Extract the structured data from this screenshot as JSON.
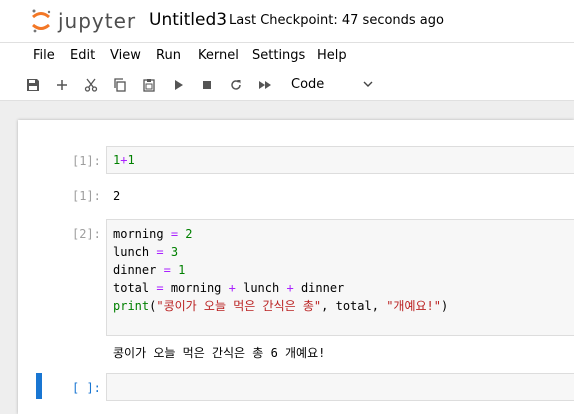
{
  "header": {
    "logo_text": "jupyter",
    "notebook_title": "Untitled3",
    "checkpoint": "Last Checkpoint: 47 seconds ago"
  },
  "menu": [
    "File",
    "Edit",
    "View",
    "Run",
    "Kernel",
    "Settings",
    "Help"
  ],
  "toolbar": {
    "icons": [
      "save-icon",
      "add-icon",
      "cut-icon",
      "copy-icon",
      "paste-icon",
      "run-icon",
      "stop-icon",
      "restart-icon",
      "fast-forward-icon"
    ],
    "cell_type": "Code"
  },
  "cells": [
    {
      "prompt": "[1]:",
      "code": "1+1",
      "output_prompt": "[1]:",
      "output": "2"
    },
    {
      "prompt": "[2]:",
      "lines": {
        "l1_var": "morning",
        "l1_val": "2",
        "l2_var": "lunch",
        "l2_val": "3",
        "l3_var": "dinner",
        "l3_val": "1",
        "l4_var": "total",
        "l4_a": "morning",
        "l4_b": "lunch",
        "l4_c": "dinner",
        "l5_fn": "print",
        "l5_str1": "\"콩이가 오늘 먹은 간식은 총\"",
        "l5_mid": ", total, ",
        "l5_str2": "\"개예요!\""
      },
      "output": "콩이가 오늘 먹은 간식은 총 6 개예요!"
    },
    {
      "prompt": "[ ]:"
    }
  ],
  "colors": {
    "accent": "#1976d2",
    "number": "#008000",
    "operator": "#aa22ff",
    "string": "#ba2121",
    "logo_orange": "#f37726"
  }
}
